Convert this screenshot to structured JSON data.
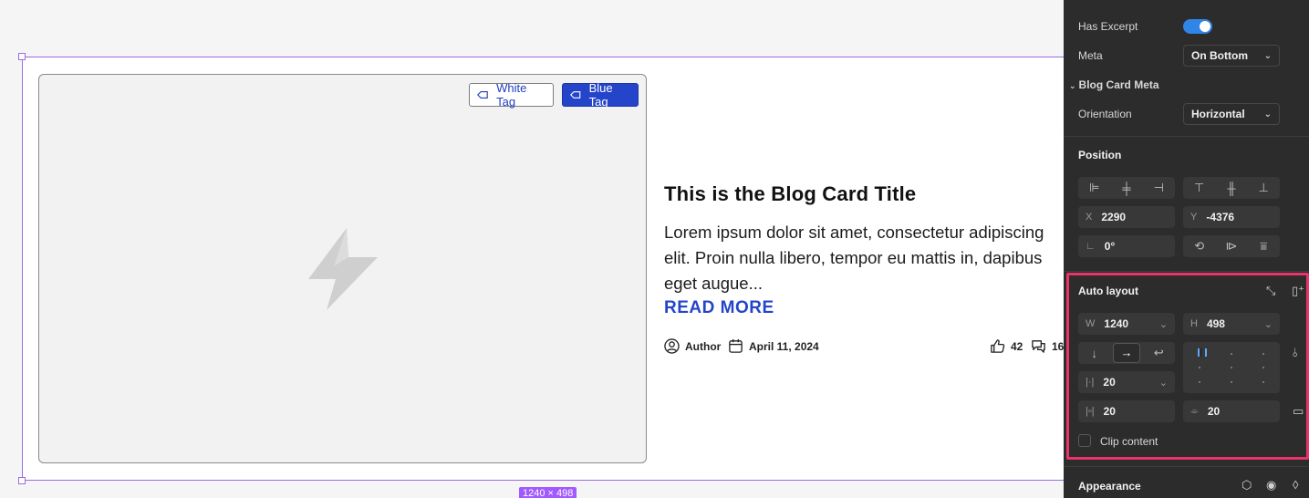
{
  "canvas": {
    "size_badge": "1240 × 498",
    "tags": {
      "white": "White Tag",
      "blue": "Blue Tag"
    },
    "card": {
      "title": "This is the Blog Card Title",
      "excerpt": "Lorem ipsum dolor sit amet, consectetur adipiscing elit. Proin nulla libero, tempor eu mattis in, dapibus eget augue...",
      "read_more": "READ MORE",
      "author": "Author",
      "date": "April 11, 2024",
      "likes": "42",
      "comments": "16"
    }
  },
  "panel": {
    "has_excerpt_label": "Has Excerpt",
    "has_excerpt_on": true,
    "meta_label": "Meta",
    "meta_value": "On Bottom",
    "blog_card_meta_heading": "Blog Card Meta",
    "orientation_label": "Orientation",
    "orientation_value": "Horizontal",
    "position_heading": "Position",
    "x_prefix": "X",
    "x_value": "2290",
    "y_prefix": "Y",
    "y_value": "-4376",
    "rotation_value": "0°",
    "auto_layout_heading": "Auto layout",
    "w_prefix": "W",
    "w_value": "1240",
    "h_prefix": "H",
    "h_value": "498",
    "gap_value": "20",
    "padding_h_value": "20",
    "padding_v_value": "20",
    "clip_content_label": "Clip content",
    "appearance_heading": "Appearance"
  },
  "colors": {
    "frame_selection": "#9b6be6",
    "blue_tag": "#2445c9",
    "highlight": "#e8336b",
    "toggle_on": "#2f86e6"
  }
}
